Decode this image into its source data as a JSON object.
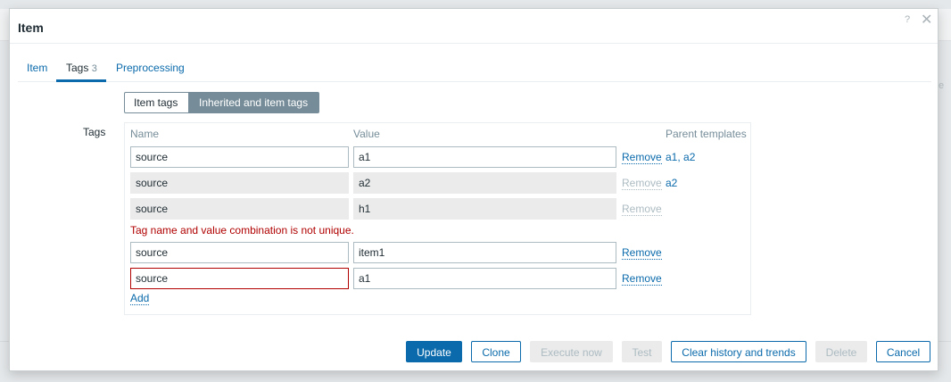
{
  "dialog": {
    "title": "Item",
    "help_glyph": "?",
    "close_glyph": "✕"
  },
  "tabs": [
    {
      "label": "Item"
    },
    {
      "label": "Tags",
      "count": "3"
    },
    {
      "label": "Preprocessing"
    }
  ],
  "tag_mode": {
    "options": [
      "Item tags",
      "Inherited and item tags"
    ],
    "selected": "Inherited and item tags"
  },
  "tags_section": {
    "label": "Tags",
    "columns": {
      "name": "Name",
      "value": "Value",
      "parents": "Parent templates"
    },
    "rows": [
      {
        "name": "source",
        "value": "a1",
        "editable": true,
        "remove": "Remove",
        "parents": [
          "a1",
          "a2"
        ]
      },
      {
        "name": "source",
        "value": "a2",
        "editable": false,
        "remove": "Remove",
        "parents": [
          "a2"
        ]
      },
      {
        "name": "source",
        "value": "h1",
        "editable": false,
        "remove": "Remove",
        "parents": []
      },
      {
        "name": "source",
        "value": "item1",
        "editable": true,
        "remove": "Remove",
        "parents": []
      },
      {
        "name": "source",
        "value": "a1",
        "editable": true,
        "error": true,
        "remove": "Remove",
        "parents": []
      }
    ],
    "error_message": "Tag name and value combination is not unique.",
    "add_label": "Add"
  },
  "footer": {
    "update": "Update",
    "clone": "Clone",
    "execute_now": "Execute now",
    "test": "Test",
    "clear_history": "Clear history and trends",
    "delete": "Delete",
    "cancel": "Cancel"
  },
  "colors": {
    "accent": "#0a6aab",
    "error": "#b00000",
    "segment_selected": "#768d99",
    "disabled_bg": "#ebebeb"
  },
  "background": {
    "edge_glyph": "e"
  }
}
